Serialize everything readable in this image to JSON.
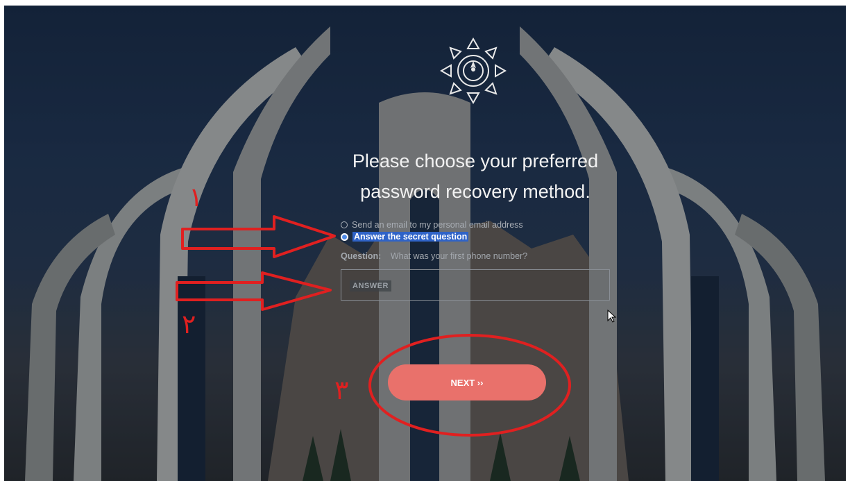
{
  "page": {
    "title_line1": "Please choose your preferred",
    "title_line2": "password recovery method."
  },
  "options": {
    "email_label": "Send an email to my personal email address",
    "secret_label": "Answer the secret question",
    "selected": "secret"
  },
  "question": {
    "label": "Question:",
    "text": "What was your first phone number?"
  },
  "answer": {
    "placeholder": "ANSWER",
    "value": ""
  },
  "next_button": {
    "label": "NEXT ››"
  },
  "annotations": {
    "marker1": "۱",
    "marker2": "۲",
    "marker3": "۳"
  },
  "colors": {
    "accent_button": "#e9716b",
    "annotation_red": "#e02020",
    "selection_blue": "#2f63c7"
  }
}
